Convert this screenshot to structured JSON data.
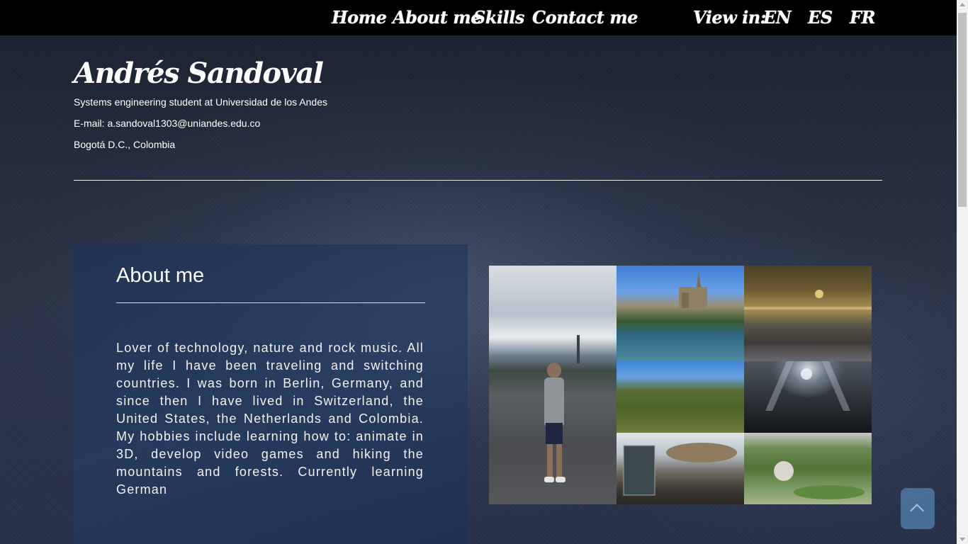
{
  "nav": {
    "links": [
      "Home",
      "About me",
      "Skills",
      "Contact me"
    ],
    "view_in_label": "View in:",
    "languages": [
      "EN",
      "ES",
      "FR"
    ]
  },
  "header": {
    "name": "Andrés Sandoval",
    "role": "Systems engineering student at Universidad de los Andes",
    "email": "E-mail: a.sandoval1303@uniandes.edu.co",
    "location": "Bogotá D.C., Colombia"
  },
  "about": {
    "title": "About me",
    "text": "Lover of technology, nature and rock music. All my life I have been traveling and switching countries. I was born in Berlin, Germany, and since then I have lived in Switzerland, the United States, the Netherlands and Colombia. My hobbies include learning how to: animate in 3D, develop video games and hiking the mountains and forests. Currently learning German"
  },
  "gallery": {
    "photos": [
      "person-standing-on-bridge",
      "river-and-cathedral",
      "train-station-hall",
      "green-hills",
      "rock-concert",
      "glass-building-and-fish-sculpture",
      "garden-with-hedges"
    ]
  },
  "colors": {
    "navbar": "#000000",
    "panel": "#233d63",
    "back_to_top": "#4c74a0"
  },
  "icons": {
    "back_to_top": "chevron-up-icon"
  }
}
